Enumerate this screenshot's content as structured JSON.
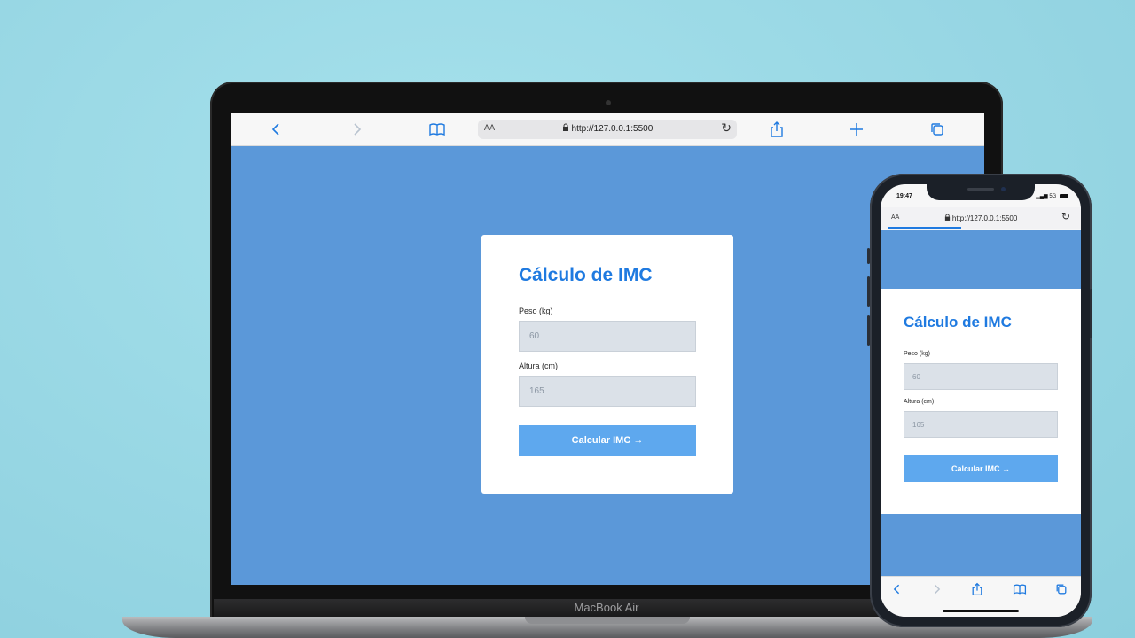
{
  "laptop": {
    "brand_label": "MacBook Air",
    "browser": {
      "text_size_label": "AA",
      "url": "http://127.0.0.1:5500",
      "icons": [
        "back-icon",
        "forward-icon",
        "bookmarks-icon",
        "lock-icon",
        "reload-icon",
        "share-icon",
        "new-tab-icon",
        "tabs-icon"
      ]
    }
  },
  "phone": {
    "status": {
      "time": "19:47",
      "network": "5G"
    },
    "browser": {
      "text_size_label": "AA",
      "url": "http://127.0.0.1:5500"
    }
  },
  "form": {
    "title": "Cálculo de IMC",
    "weight_label": "Peso (kg)",
    "weight_placeholder": "60",
    "height_label": "Altura (cm)",
    "height_placeholder": "165",
    "button_label": "Calcular IMC →"
  },
  "colors": {
    "page_background": "#5b98d9",
    "accent": "#1f7ae0",
    "button": "#5ea8ee",
    "input_background": "#dbe1e8"
  }
}
